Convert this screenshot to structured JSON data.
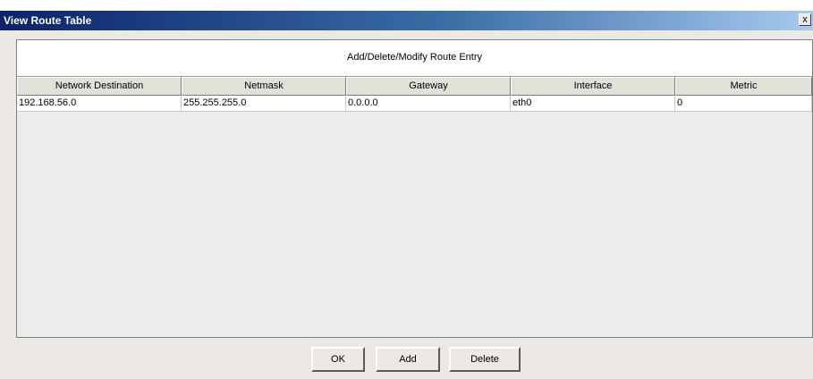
{
  "window": {
    "title": "View Route Table",
    "close_glyph": "x"
  },
  "panel": {
    "title": "Add/Delete/Modify Route Entry"
  },
  "table": {
    "columns": [
      "Network Destination",
      "Netmask",
      "Gateway",
      "Interface",
      "Metric"
    ],
    "rows": [
      [
        "192.168.56.0",
        "255.255.255.0",
        "0.0.0.0",
        "eth0",
        "0"
      ]
    ]
  },
  "buttons": {
    "ok": "OK",
    "add": "Add",
    "delete": "Delete"
  }
}
